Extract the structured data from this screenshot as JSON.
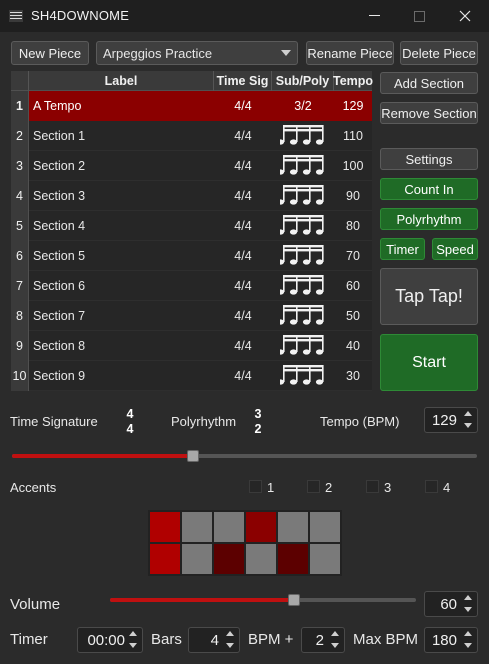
{
  "window": {
    "title": "SH4DOWNOME"
  },
  "toolbar": {
    "new_piece": "New Piece",
    "piece_selected": "Arpeggios Practice",
    "rename_piece": "Rename Piece",
    "delete_piece": "Delete Piece"
  },
  "table": {
    "headers": {
      "label": "Label",
      "time_sig": "Time Sig",
      "sub_poly": "Sub/Poly",
      "tempo": "Tempo"
    },
    "rows": [
      {
        "index": "1",
        "label": "A Tempo",
        "time_sig": "4/4",
        "sub_poly": "3/2",
        "tempo": "129"
      },
      {
        "index": "2",
        "label": "Section 1",
        "time_sig": "4/4",
        "sub_poly": "",
        "tempo": "110"
      },
      {
        "index": "3",
        "label": "Section 2",
        "time_sig": "4/4",
        "sub_poly": "",
        "tempo": "100"
      },
      {
        "index": "4",
        "label": "Section 3",
        "time_sig": "4/4",
        "sub_poly": "",
        "tempo": "90"
      },
      {
        "index": "5",
        "label": "Section 4",
        "time_sig": "4/4",
        "sub_poly": "",
        "tempo": "80"
      },
      {
        "index": "6",
        "label": "Section 5",
        "time_sig": "4/4",
        "sub_poly": "",
        "tempo": "70"
      },
      {
        "index": "7",
        "label": "Section 6",
        "time_sig": "4/4",
        "sub_poly": "",
        "tempo": "60"
      },
      {
        "index": "8",
        "label": "Section 7",
        "time_sig": "4/4",
        "sub_poly": "",
        "tempo": "50"
      },
      {
        "index": "9",
        "label": "Section 8",
        "time_sig": "4/4",
        "sub_poly": "",
        "tempo": "40"
      },
      {
        "index": "10",
        "label": "Section 9",
        "time_sig": "4/4",
        "sub_poly": "",
        "tempo": "30"
      }
    ],
    "selected_row": 0,
    "sub_icon": "sixteenth-notes-icon"
  },
  "side": {
    "add_section": "Add Section",
    "remove_section": "Remove Section",
    "settings": "Settings",
    "count_in": "Count In",
    "polyrhythm": "Polyrhythm",
    "timer": "Timer",
    "speed": "Speed",
    "tap": "Tap Tap!",
    "start": "Start"
  },
  "controls": {
    "time_signature_label": "Time Signature",
    "time_signature_top": "4",
    "time_signature_bottom": "4",
    "polyrhythm_label": "Polyrhythm",
    "polyrhythm_top": "3",
    "polyrhythm_bottom": "2",
    "tempo_label": "Tempo (BPM)",
    "tempo_value": "129",
    "tempo_slider_fraction": 0.39
  },
  "accents": {
    "label": "Accents",
    "checkboxes": [
      "1",
      "2",
      "3",
      "4"
    ],
    "grid": [
      [
        "#b00000",
        "#7a7a7a",
        "#7a7a7a",
        "#8b0000",
        "#7a7a7a",
        "#7a7a7a"
      ],
      [
        "#b00000",
        "#7a7a7a",
        "#5c0000",
        "#7a7a7a",
        "#5c0000",
        "#7a7a7a"
      ]
    ]
  },
  "volume": {
    "label": "Volume",
    "value": "60",
    "slider_fraction": 0.6
  },
  "timer_row": {
    "label": "Timer",
    "time": "00:00",
    "bars_label": "Bars",
    "bars": "4",
    "bpm_plus_label": "BPM +",
    "bpm_plus": "2",
    "max_bpm_label": "Max BPM",
    "max_bpm": "180"
  },
  "colors": {
    "accent_red": "#c01010",
    "selected_row": "#8b0000",
    "green": "#1f6b26"
  }
}
